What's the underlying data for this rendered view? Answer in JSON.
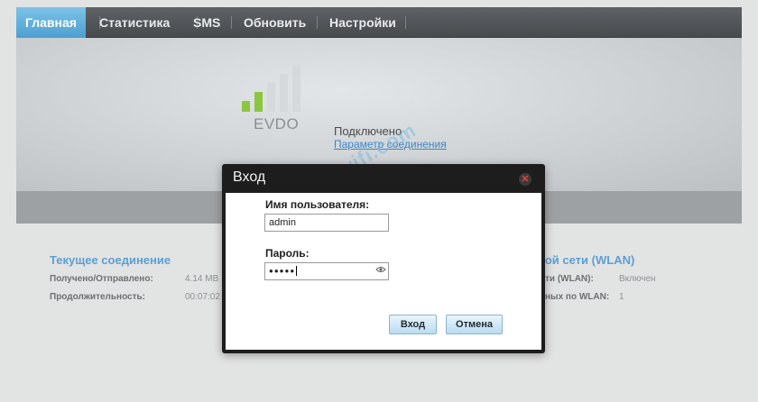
{
  "nav": {
    "items": [
      {
        "label": "Главная",
        "active": true
      },
      {
        "label": "Статистика",
        "active": false
      },
      {
        "label": "SMS",
        "active": false
      },
      {
        "label": "Обновить",
        "active": false
      },
      {
        "label": "Настройки",
        "active": false
      }
    ]
  },
  "banner": {
    "network_type": "EVDO",
    "status": "Подключено",
    "connection_params_link": "Параметр соединения",
    "signal_level": 0.4
  },
  "watermark": "help-wifi.com",
  "current_connection": {
    "title": "Текущее соединение",
    "rows": [
      {
        "label": "Получено/Отправлено:",
        "value": "4.14 MB"
      },
      {
        "label": "Продолжительность:",
        "value": "00:07:02"
      }
    ]
  },
  "wlan": {
    "title": "ной сети (WLAN)",
    "rows": [
      {
        "label": "ти (WLAN):",
        "value": "Включен"
      },
      {
        "label": "ных по WLAN:",
        "value": "1"
      }
    ]
  },
  "login_dialog": {
    "title": "Вход",
    "username_label": "Имя пользователя:",
    "username_value": "admin",
    "password_label": "Пароль:",
    "password_masked": "●●●●●",
    "login_button": "Вход",
    "cancel_button": "Отмена"
  },
  "colors": {
    "nav_active": "#5aaddc",
    "signal_on": "#8cc63e",
    "signal_off": "#d6d9db",
    "link": "#3f86c6",
    "section_title": "#5c9fd2"
  },
  "icons": {
    "close": "close-icon",
    "eye": "eye-icon",
    "signal": "signal-strength-icon"
  }
}
